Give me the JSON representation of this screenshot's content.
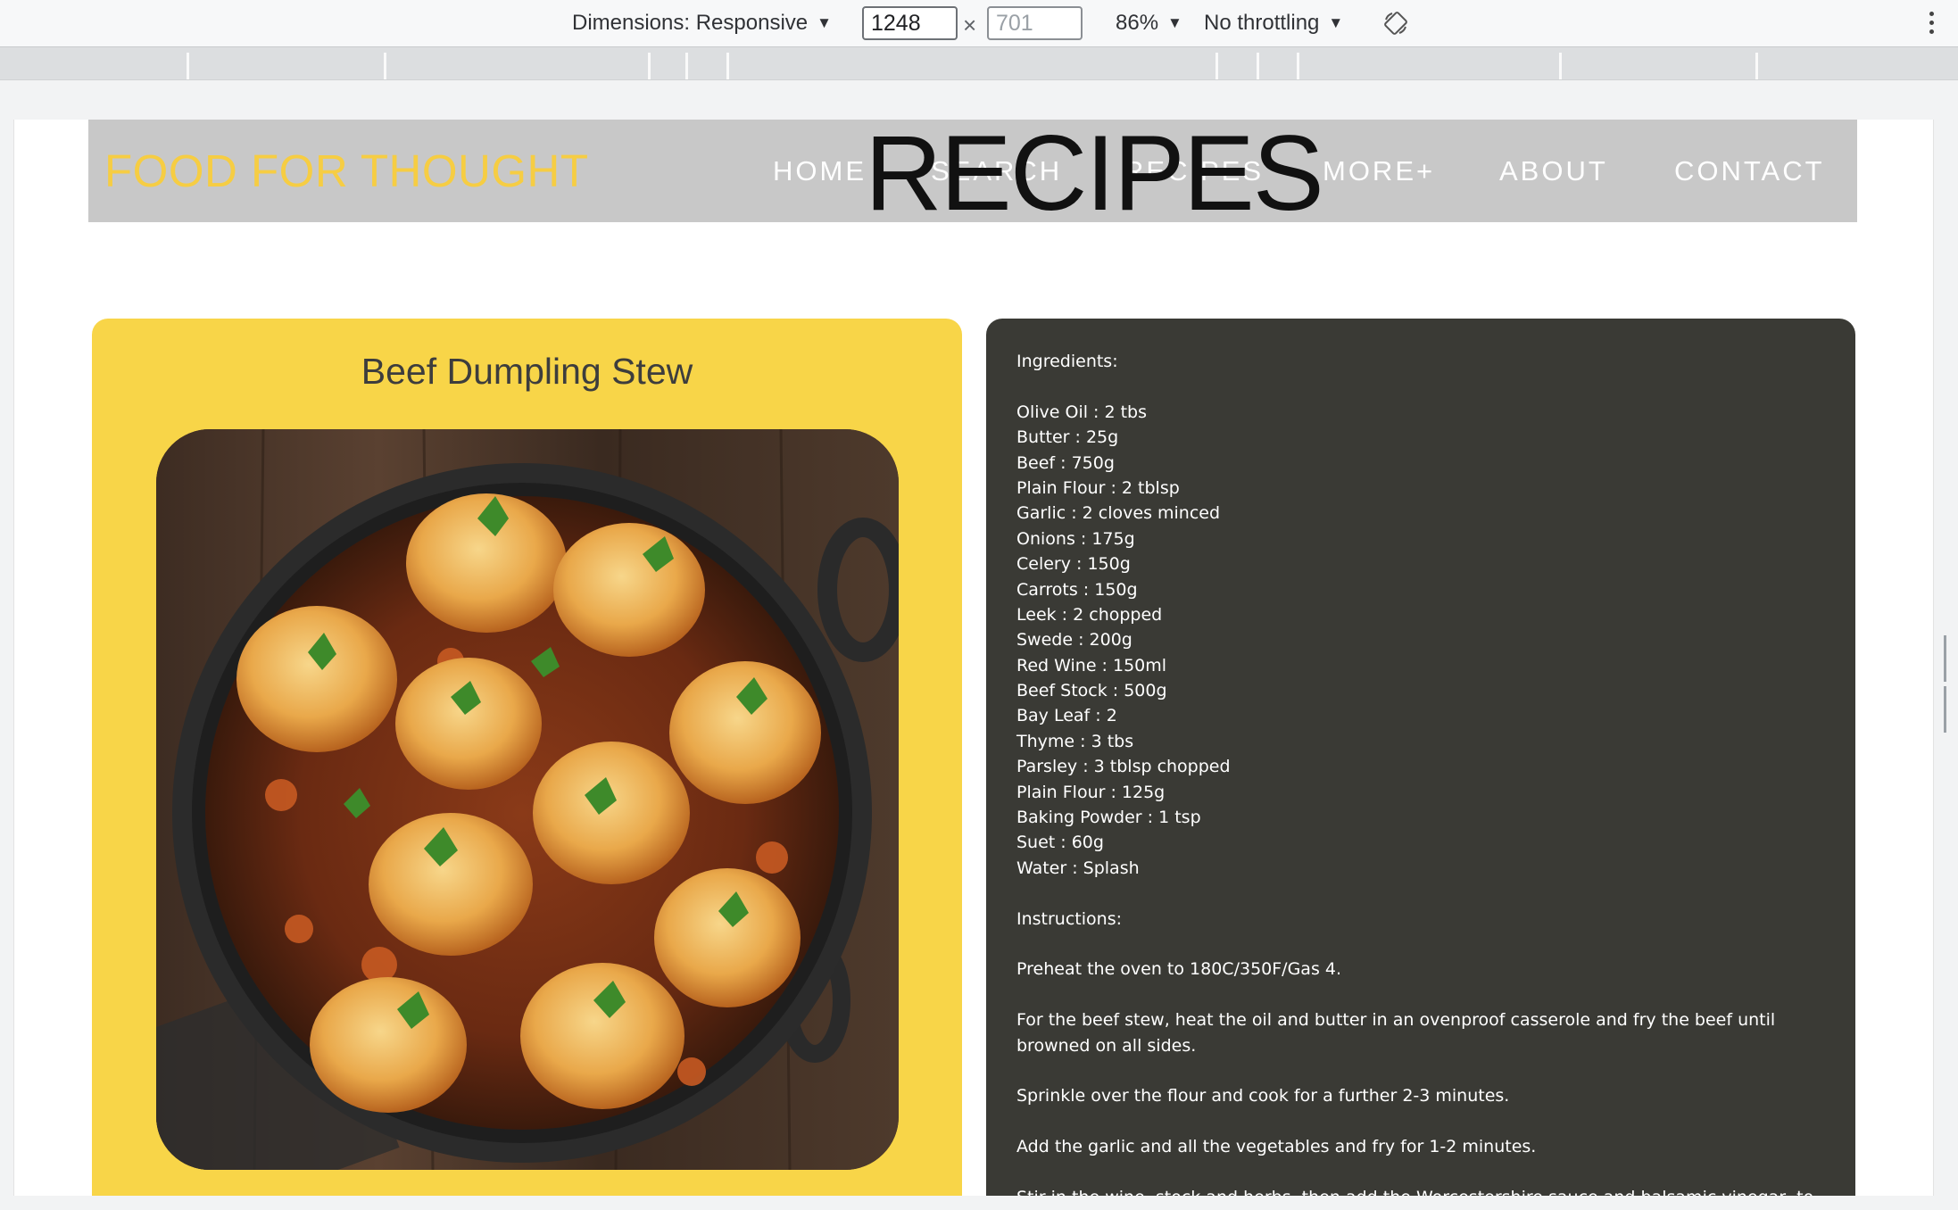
{
  "devtools": {
    "dimensions_label": "Dimensions: Responsive",
    "width_value": "1248",
    "height_value": "701",
    "times": "×",
    "zoom": "86%",
    "throttling": "No throttling"
  },
  "site": {
    "logo": "FOOD FOR THOUGHT",
    "page_heading": "RECIPES",
    "nav": [
      "HOME",
      "SEARCH",
      "RECIPES",
      "MORE+",
      "ABOUT",
      "CONTACT"
    ]
  },
  "recipe": {
    "title": "Beef Dumpling Stew",
    "ingredients_heading": "Ingredients:",
    "ingredients": [
      "Olive Oil : 2 tbs",
      "Butter : 25g",
      "Beef : 750g",
      "Plain Flour : 2 tblsp",
      "Garlic : 2 cloves minced",
      "Onions : 175g",
      "Celery : 150g",
      "Carrots : 150g",
      "Leek : 2 chopped",
      "Swede : 200g",
      "Red Wine : 150ml",
      "Beef Stock : 500g",
      "Bay Leaf : 2",
      "Thyme : 3 tbs",
      "Parsley : 3 tblsp chopped",
      "Plain Flour : 125g",
      "Baking Powder : 1 tsp",
      "Suet : 60g",
      "Water : Splash"
    ],
    "instructions_heading": "Instructions:",
    "instructions": [
      "Preheat the oven to 180C/350F/Gas 4.",
      "For the beef stew, heat the oil and butter in an ovenproof casserole and fry the beef until browned on all sides.",
      "Sprinkle over the flour and cook for a further 2-3 minutes.",
      "Add the garlic and all the vegetables and fry for 1-2 minutes.",
      "Stir in the wine, stock and herbs, then add the Worcestershire sauce and balsamic vinegar, to"
    ]
  }
}
